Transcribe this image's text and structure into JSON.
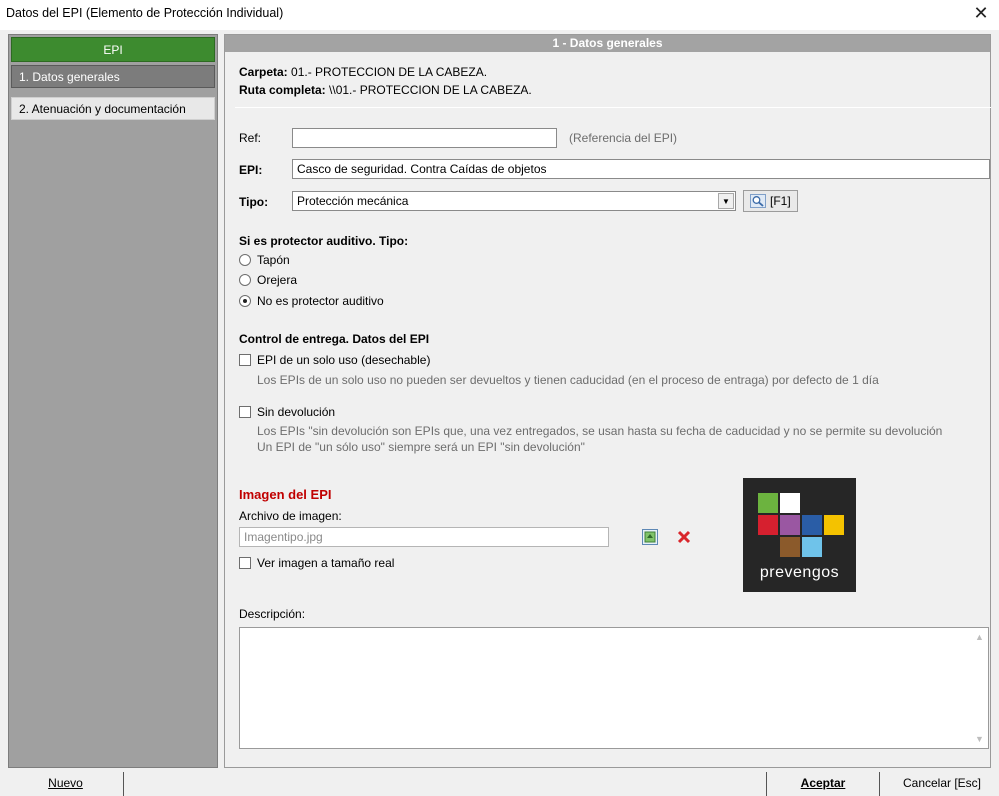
{
  "window": {
    "title": "Datos del EPI (Elemento de Protección Individual)",
    "close_symbol": "✕"
  },
  "sidebar": {
    "header": "EPI",
    "items": [
      {
        "label": "1. Datos generales"
      },
      {
        "label": "2. Atenuación y documentación"
      }
    ]
  },
  "panel": {
    "header": "1 - Datos generales",
    "carpeta_label": "Carpeta:",
    "carpeta_value": "01.- PROTECCION DE LA CABEZA.",
    "ruta_label": "Ruta completa:",
    "ruta_value": "\\\\01.- PROTECCION DE LA CABEZA.",
    "ref_label": "Ref:",
    "ref_value": "",
    "ref_hint": "(Referencia del EPI)",
    "epi_label": "EPI:",
    "epi_value": "Casco de seguridad. Contra Caídas de objetos",
    "tipo_label": "Tipo:",
    "tipo_value": "Protección mecánica",
    "f1_label": "[F1]"
  },
  "auditivo": {
    "title": "Si es protector auditivo. Tipo:",
    "options": [
      {
        "label": "Tapón",
        "checked": false
      },
      {
        "label": "Orejera",
        "checked": false
      },
      {
        "label": "No es protector auditivo",
        "checked": true
      }
    ]
  },
  "entrega": {
    "title": "Control de entrega. Datos del EPI",
    "solo_uso_label": "EPI de un solo uso (desechable)",
    "solo_uso_checked": false,
    "solo_uso_help": "Los EPIs de un solo uso no pueden ser devueltos y tienen caducidad (en el proceso de entraga) por defecto de 1 día",
    "sin_devolucion_label": "Sin devolución",
    "sin_devolucion_checked": false,
    "sin_devolucion_help1": "Los EPIs \"sin devolución son EPIs que, una vez entregados, se usan hasta su fecha de caducidad y no se permite su devolución",
    "sin_devolucion_help2": "Un EPI de \"un sólo uso\" siempre será un EPI \"sin devolución\""
  },
  "imagen": {
    "title": "Imagen del EPI",
    "archivo_label": "Archivo de imagen:",
    "archivo_value": "Imagentipo.jpg",
    "ver_real_label": "Ver imagen a tamaño real",
    "ver_real_checked": false,
    "logo_text": "prevengos"
  },
  "descripcion": {
    "label": "Descripción:",
    "value": ""
  },
  "buttons": {
    "nuevo": "Nuevo",
    "aceptar": "Aceptar",
    "cancelar": "Cancelar [Esc]"
  },
  "colors": {
    "sidebar_header": "#3d8b2f",
    "image_title": "#c00000",
    "logo_background": "#262626"
  }
}
